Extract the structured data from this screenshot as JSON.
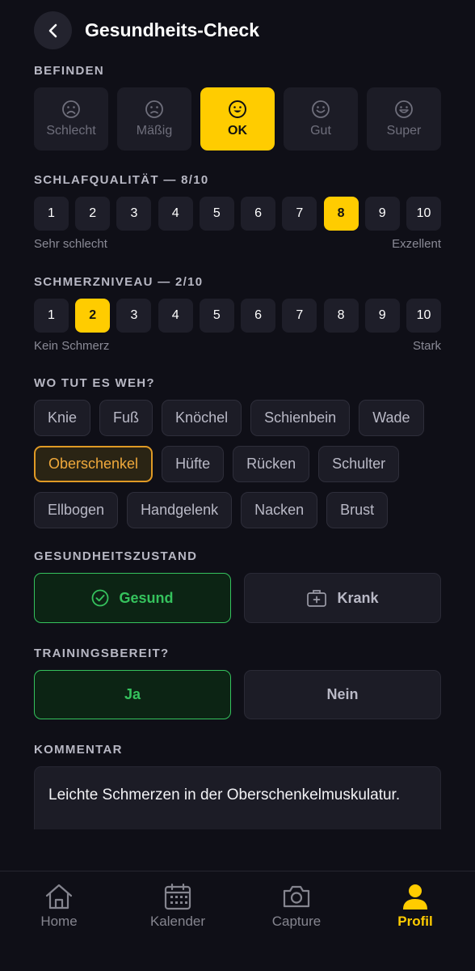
{
  "header": {
    "title": "Gesundheits-Check"
  },
  "mood": {
    "label": "BEFINDEN",
    "options": [
      {
        "label": "Schlecht",
        "icon": "sad-face-icon"
      },
      {
        "label": "Mäßig",
        "icon": "sad-face-icon"
      },
      {
        "label": "OK",
        "icon": "smile-face-icon"
      },
      {
        "label": "Gut",
        "icon": "smile-face-icon"
      },
      {
        "label": "Super",
        "icon": "smile-face-icon"
      }
    ],
    "selected": "OK"
  },
  "sleep": {
    "label": "SCHLAFQUALITÄT — 8/10",
    "values": [
      "1",
      "2",
      "3",
      "4",
      "5",
      "6",
      "7",
      "8",
      "9",
      "10"
    ],
    "selected": 8,
    "min_label": "Sehr schlecht",
    "max_label": "Exzellent"
  },
  "pain": {
    "label": "SCHMERZNIVEAU — 2/10",
    "values": [
      "1",
      "2",
      "3",
      "4",
      "5",
      "6",
      "7",
      "8",
      "9",
      "10"
    ],
    "selected": 2,
    "min_label": "Kein Schmerz",
    "max_label": "Stark"
  },
  "body_parts": {
    "label": "WO TUT ES WEH?",
    "rows": [
      [
        "Knie",
        "Fuß",
        "Knöchel",
        "Schienbein",
        "Wade"
      ],
      [
        "Oberschenkel",
        "Hüfte",
        "Rücken",
        "Schulter"
      ],
      [
        "Ellbogen",
        "Handgelenk",
        "Nacken",
        "Brust"
      ]
    ],
    "selected": "Oberschenkel"
  },
  "health": {
    "label": "GESUNDHEITSZUSTAND",
    "options": [
      "Gesund",
      "Krank"
    ],
    "selected": "Gesund"
  },
  "training": {
    "label": "TRAININGSBEREIT?",
    "options": [
      "Ja",
      "Nein"
    ],
    "selected": "Ja"
  },
  "comment": {
    "label": "KOMMENTAR",
    "value": "Leichte Schmerzen in der Oberschenkelmuskulatur."
  },
  "nav": {
    "items": [
      {
        "label": "Home",
        "icon": "home-icon"
      },
      {
        "label": "Kalender",
        "icon": "calendar-icon"
      },
      {
        "label": "Capture",
        "icon": "camera-icon"
      },
      {
        "label": "Profil",
        "icon": "profile-icon"
      }
    ],
    "active": "Profil"
  },
  "colors": {
    "background": "#0f0f17",
    "accent": "#ffcc00",
    "success": "#35c25d",
    "chip_selected": "#e09a25"
  }
}
